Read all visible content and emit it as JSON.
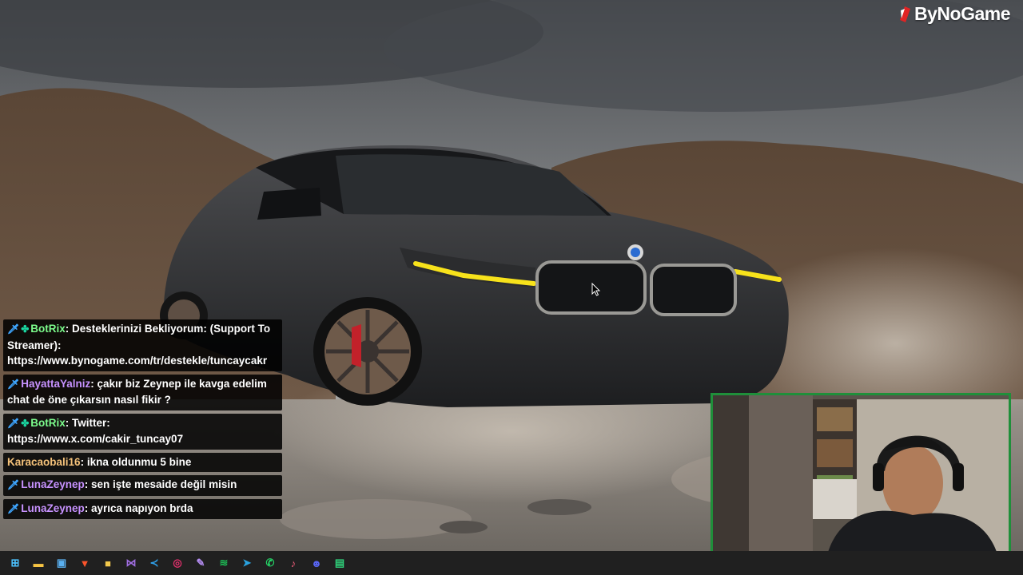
{
  "overlay": {
    "brand": "ByNoGame"
  },
  "chat": {
    "messages": [
      {
        "badges": [
          "mod",
          "bot"
        ],
        "user": "BotRix",
        "user_color": "#7cfc8c",
        "text": "Desteklerinizi Bekliyorum: (Support To Streamer): https://www.bynogame.com/tr/destekle/tuncaycakr"
      },
      {
        "badges": [
          "mod"
        ],
        "user": "HayattaYalniz",
        "user_color": "#c792ff",
        "text": "çakır biz Zeynep ile kavga edelim chat de öne çıkarsın nasıl fikir ?"
      },
      {
        "badges": [
          "mod",
          "bot"
        ],
        "user": "BotRix",
        "user_color": "#7cfc8c",
        "text": "Twitter: https://www.x.com/cakir_tuncay07"
      },
      {
        "badges": [],
        "user": "Karacaobali16",
        "user_color": "#f5c27a",
        "text": "ikna oldunmu 5 bine"
      },
      {
        "badges": [
          "mod"
        ],
        "user": "LunaZeynep",
        "user_color": "#c792ff",
        "text": "sen işte mesaide değil misin"
      },
      {
        "badges": [
          "mod"
        ],
        "user": "LunaZeynep",
        "user_color": "#c792ff",
        "text": "ayrıca napıyon brda"
      }
    ]
  },
  "webcam": {
    "border_color": "#1f8f3a"
  },
  "taskbar": {
    "icons": [
      {
        "name": "windows-start-icon",
        "glyph": "⊞",
        "color": "#4cc2ff"
      },
      {
        "name": "file-explorer-icon",
        "glyph": "▬",
        "color": "#f6c443"
      },
      {
        "name": "photos-icon",
        "glyph": "▣",
        "color": "#5ab0f0"
      },
      {
        "name": "brave-browser-icon",
        "glyph": "▼",
        "color": "#fb542b"
      },
      {
        "name": "sticky-app-icon",
        "glyph": "■",
        "color": "#f2c94c"
      },
      {
        "name": "visual-studio-icon",
        "glyph": "⋈",
        "color": "#a06ee1"
      },
      {
        "name": "vscode-icon",
        "glyph": "≺",
        "color": "#2f9fe8"
      },
      {
        "name": "instagram-icon",
        "glyph": "◎",
        "color": "#e1306c"
      },
      {
        "name": "feather-app-icon",
        "glyph": "✎",
        "color": "#b38cf0"
      },
      {
        "name": "spotify-icon",
        "glyph": "≋",
        "color": "#1db954"
      },
      {
        "name": "telegram-icon",
        "glyph": "➤",
        "color": "#2aa3e0"
      },
      {
        "name": "whatsapp-icon",
        "glyph": "✆",
        "color": "#25d366"
      },
      {
        "name": "music-app-icon",
        "glyph": "♪",
        "color": "#f05d7a"
      },
      {
        "name": "discord-icon",
        "glyph": "☻",
        "color": "#5865f2"
      },
      {
        "name": "streaming-app-icon",
        "glyph": "▤",
        "color": "#2fd17a"
      }
    ]
  }
}
